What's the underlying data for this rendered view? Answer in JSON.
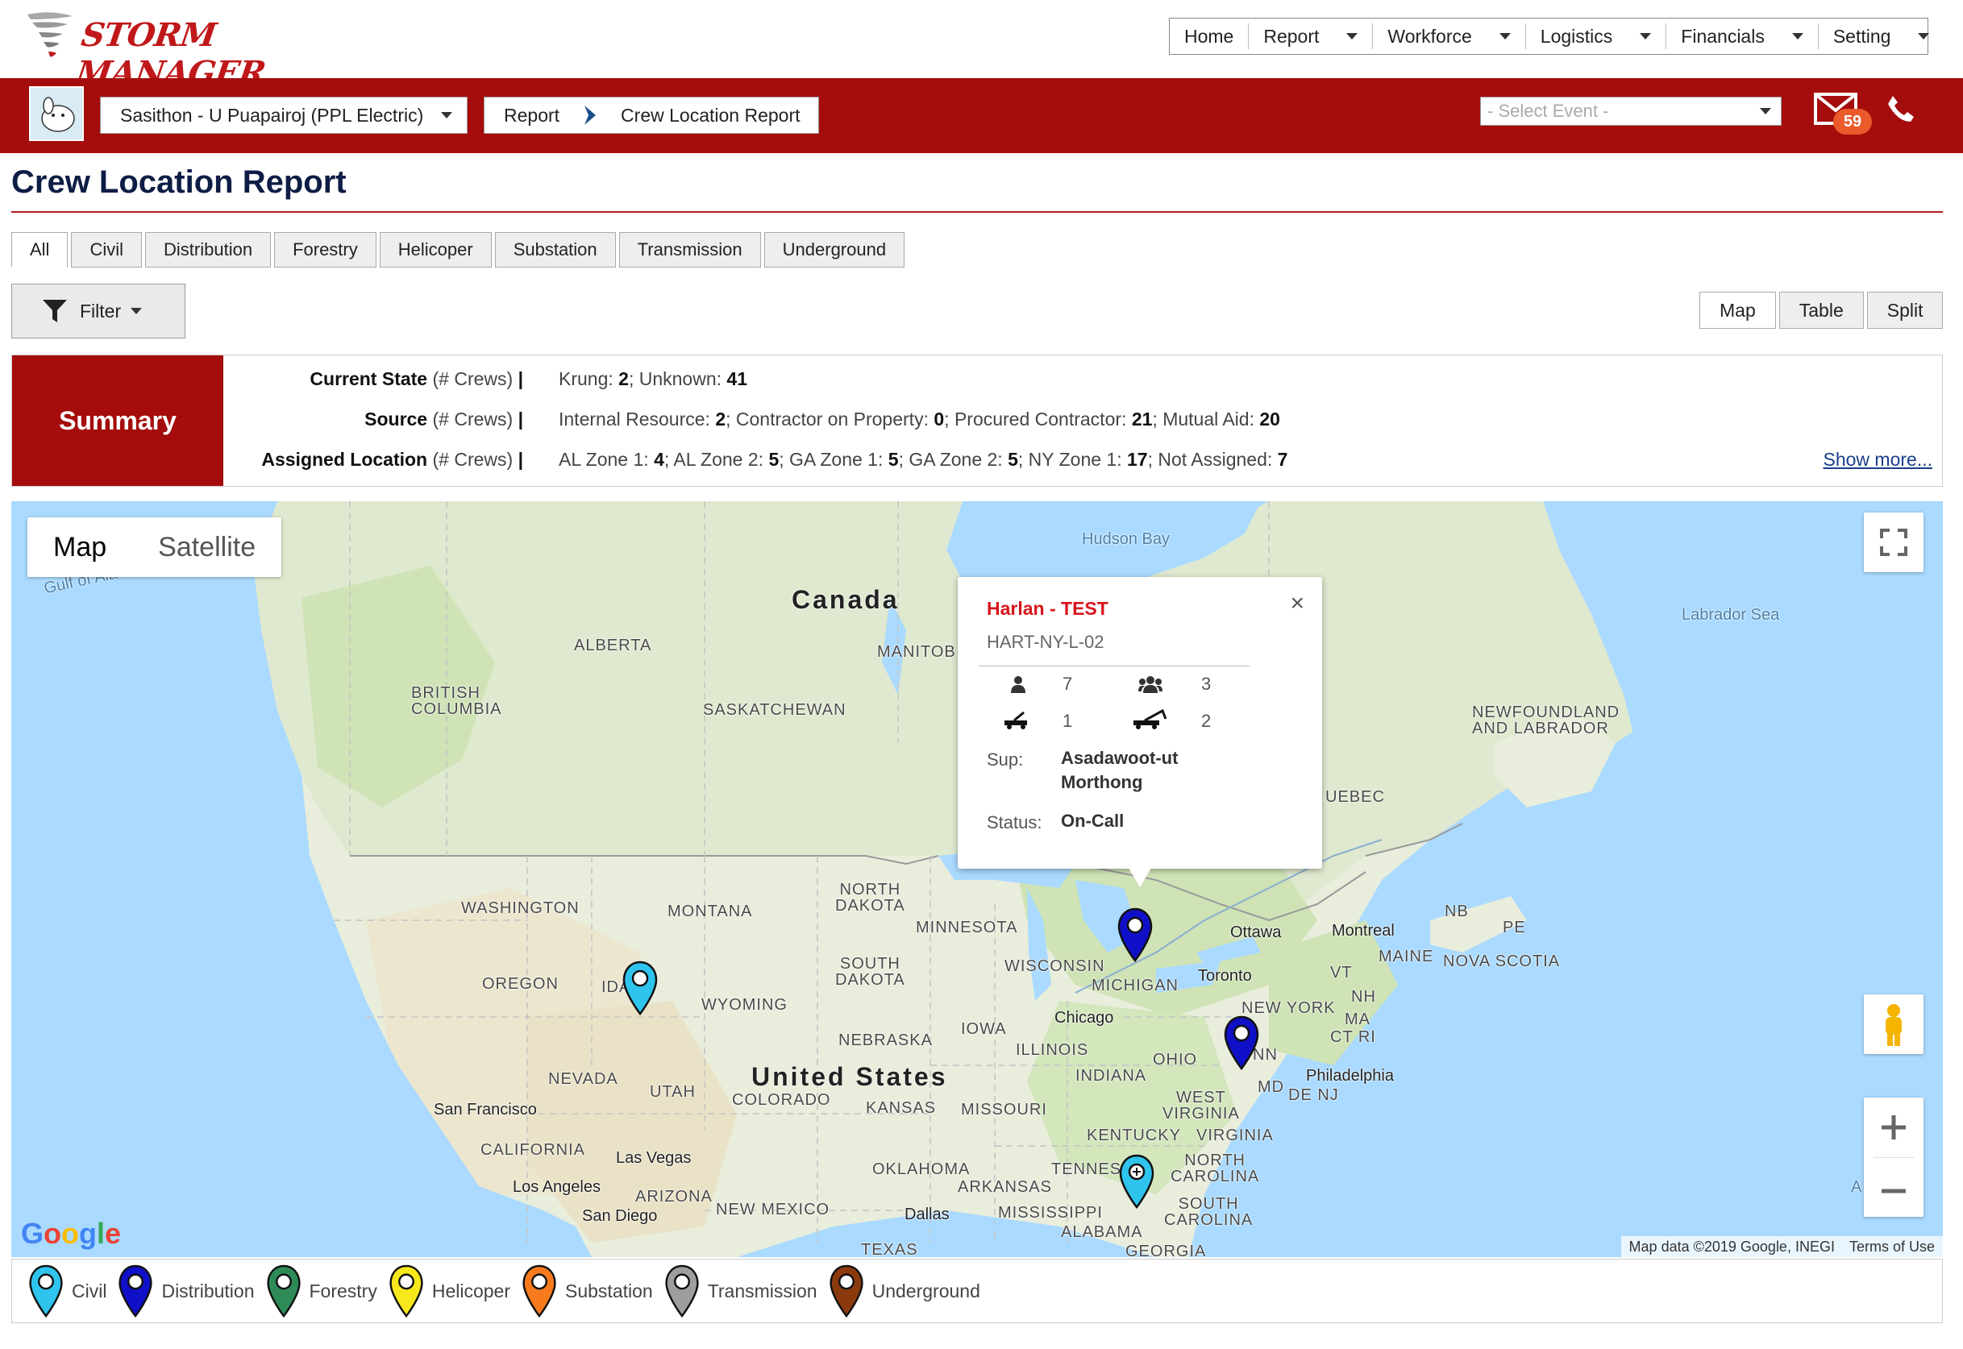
{
  "app": {
    "logo_text": "STORM MANAGER"
  },
  "topnav": {
    "items": [
      {
        "label": "Home",
        "dropdown": false
      },
      {
        "label": "Report",
        "dropdown": true
      },
      {
        "label": "Workforce",
        "dropdown": true
      },
      {
        "label": "Logistics",
        "dropdown": true
      },
      {
        "label": "Financials",
        "dropdown": true
      },
      {
        "label": "Setting",
        "dropdown": true
      }
    ]
  },
  "header": {
    "user_select": "Sasithon - U Puapairoj (PPL Electric)",
    "breadcrumb": [
      "Report",
      "Crew Location Report"
    ],
    "event_select_placeholder": "- Select Event -",
    "mail_count": "59",
    "accent_color": "#a50c0c"
  },
  "page": {
    "title": "Crew Location Report",
    "tabs": [
      "All",
      "Civil",
      "Distribution",
      "Forestry",
      "Helicoper",
      "Substation",
      "Transmission",
      "Underground"
    ],
    "active_tab": "All",
    "filter_label": "Filter",
    "views": [
      "Map",
      "Table",
      "Split"
    ],
    "active_view": "Map"
  },
  "summary": {
    "label": "Summary",
    "rows": [
      {
        "key": "Current State",
        "unit": "(# Crews)",
        "items": [
          {
            "name": "Krung",
            "value": "2"
          },
          {
            "name": "Unknown",
            "value": "41"
          }
        ]
      },
      {
        "key": "Source",
        "unit": "(# Crews)",
        "items": [
          {
            "name": "Internal Resource",
            "value": "2"
          },
          {
            "name": "Contractor on Property",
            "value": "0"
          },
          {
            "name": "Procured Contractor",
            "value": "21"
          },
          {
            "name": "Mutual Aid",
            "value": "20"
          }
        ]
      },
      {
        "key": "Assigned Location",
        "unit": "(# Crews)",
        "items": [
          {
            "name": "AL Zone 1",
            "value": "4"
          },
          {
            "name": "AL Zone 2",
            "value": "5"
          },
          {
            "name": "GA Zone 1",
            "value": "5"
          },
          {
            "name": "GA Zone 2",
            "value": "5"
          },
          {
            "name": "NY Zone 1",
            "value": "17"
          },
          {
            "name": "Not Assigned",
            "value": "7"
          }
        ]
      }
    ],
    "show_more": "Show more..."
  },
  "map": {
    "type_buttons": [
      "Map",
      "Satellite"
    ],
    "active_type": "Map",
    "google_logo": "Google",
    "attribution": "Map data ©2019 Google, INEGI",
    "terms": "Terms of Use",
    "labels": {
      "canada": "Canada",
      "us": "United States",
      "hudson_bay": "Hudson Bay",
      "labrador_sea": "Labrador Sea",
      "gulf": "Gulf of Ala",
      "alberta": "ALBERTA",
      "bc": "BRITISH\nCOLUMBIA",
      "sask": "SASKATCHEWAN",
      "manitoba": "MANITOB",
      "quebec": "UEBEC",
      "nfl": "NEWFOUNDLAND\nAND LABRADOR",
      "washington": "WASHINGTON",
      "oregon": "OREGON",
      "idaho": "IDA",
      "montana": "MONTANA",
      "wyoming": "WYOMING",
      "nevada": "NEVADA",
      "utah": "UTAH",
      "colorado": "COLORADO",
      "california": "CALIFORNIA",
      "arizona": "ARIZONA",
      "new_mexico": "NEW MEXICO",
      "north_dakota": "NORTH\nDAKOTA",
      "south_dakota": "SOUTH\nDAKOTA",
      "nebraska": "NEBRASKA",
      "kansas": "KANSAS",
      "oklahoma": "OKLAHOMA",
      "texas": "TEXAS",
      "minnesota": "MINNESOTA",
      "iowa": "IOWA",
      "missouri": "MISSOURI",
      "arkansas": "ARKANSAS",
      "mississippi": "MISSISSIPPI",
      "alabama": "ALABAMA",
      "georgia": "GEORGIA",
      "wisconsin": "WISCONSIN",
      "michigan": "MICHIGAN",
      "illinois": "ILLINOIS",
      "indiana": "INDIANA",
      "ohio": "OHIO",
      "kentucky": "KENTUCKY",
      "tennessee": "TENNES",
      "west_virginia": "WEST\nVIRGINIA",
      "virginia": "VIRGINIA",
      "north_carolina": "NORTH\nCAROLINA",
      "south_carolina": "SOUTH\nCAROLINA",
      "penn": "NN",
      "new_york": "NEW YORK",
      "vt": "VT",
      "nh": "NH",
      "ma": "MA",
      "ctri": "CT RI",
      "md": "MD",
      "denj": "DE NJ",
      "maine": "MAINE",
      "nb": "NB",
      "pe": "PE",
      "nova_scotia": "NOVA SCOTIA",
      "ottawa": "Ottawa",
      "montreal": "Montreal",
      "toronto": "Toronto",
      "chicago": "Chicago",
      "philadelphia": "Philadelphia",
      "san_francisco": "San Francisco",
      "las_vegas": "Las Vegas",
      "los_angeles": "Los Angeles",
      "san_diego": "San Diego",
      "dallas": "Dallas",
      "atlantic": "A"
    },
    "info_window": {
      "title": "Harlan - TEST",
      "code": "HART-NY-L-02",
      "person_count": "7",
      "group_count": "3",
      "truck_count": "1",
      "crane_count": "2",
      "sup_label": "Sup:",
      "sup_name": "Asadawoot-ut Morthong",
      "status_label": "Status:",
      "status_value": "On-Call"
    }
  },
  "legend": {
    "items": [
      {
        "label": "Civil",
        "color": "#2ec4ee"
      },
      {
        "label": "Distribution",
        "color": "#1010c8"
      },
      {
        "label": "Forestry",
        "color": "#2e8b57"
      },
      {
        "label": "Helicoper",
        "color": "#f7e81b"
      },
      {
        "label": "Substation",
        "color": "#f77b1d"
      },
      {
        "label": "Transmission",
        "color": "#9e9e9e"
      },
      {
        "label": "Underground",
        "color": "#8b3a0e"
      }
    ]
  }
}
